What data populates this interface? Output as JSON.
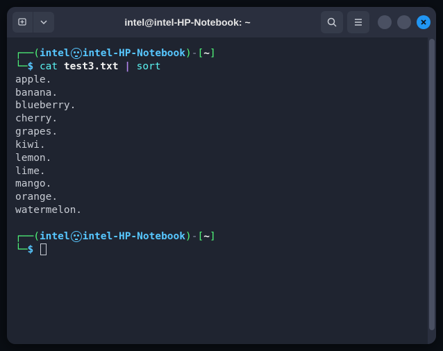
{
  "titlebar": {
    "title": "intel@intel-HP-Notebook: ~"
  },
  "prompt": {
    "user": "intel",
    "host": "intel-HP-Notebook",
    "path": "~",
    "symbol": "$",
    "open_paren": "(",
    "close_paren": ")",
    "dash": "-",
    "open_bracket": "[",
    "close_bracket": "]",
    "at": "㉿",
    "corner_top": "┌──",
    "corner_bottom": "└─"
  },
  "command": {
    "cmd1": "cat",
    "arg1": "test3.txt",
    "pipe": "|",
    "cmd2": "sort"
  },
  "output": [
    "apple.",
    "banana.",
    "blueberry.",
    "cherry.",
    "grapes.",
    "kiwi.",
    "lemon.",
    "lime.",
    "mango.",
    "orange.",
    "watermelon."
  ]
}
